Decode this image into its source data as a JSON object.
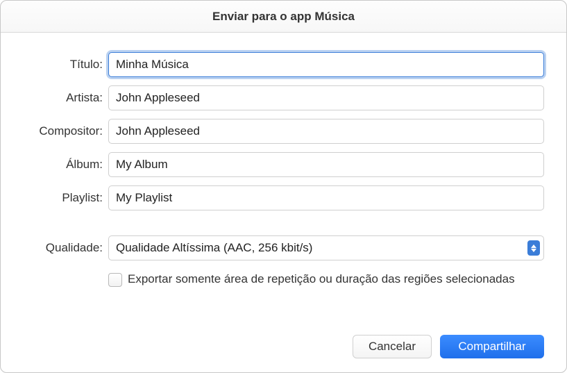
{
  "dialog": {
    "title": "Enviar para o app Música"
  },
  "form": {
    "title": {
      "label": "Título:",
      "value": "Minha Música"
    },
    "artist": {
      "label": "Artista:",
      "value": "John Appleseed"
    },
    "composer": {
      "label": "Compositor:",
      "value": "John Appleseed"
    },
    "album": {
      "label": "Álbum:",
      "value": "My Album"
    },
    "playlist": {
      "label": "Playlist:",
      "value": "My Playlist"
    },
    "quality": {
      "label": "Qualidade:",
      "value": "Qualidade Altíssima (AAC, 256 kbit/s)"
    },
    "export_checkbox": {
      "checked": false,
      "label": "Exportar somente área de repetição ou duração das regiões selecionadas"
    }
  },
  "buttons": {
    "cancel": "Cancelar",
    "share": "Compartilhar"
  }
}
